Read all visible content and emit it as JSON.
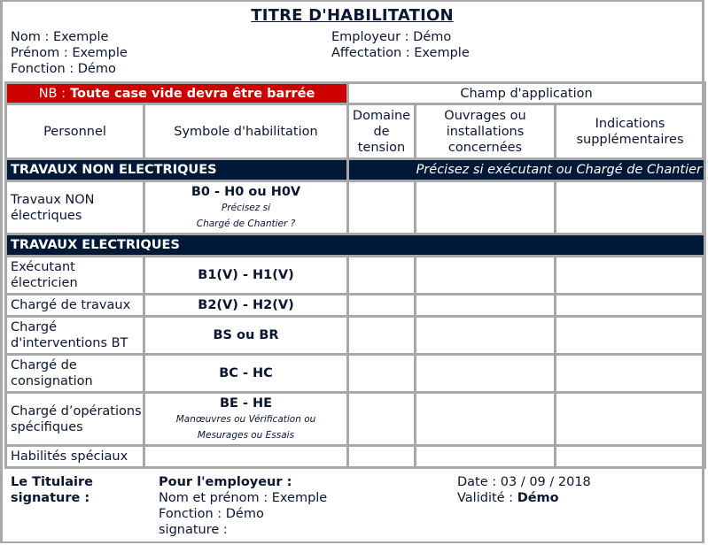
{
  "title": "TITRE D'HABILITATION",
  "person": {
    "nom_label": "Nom :",
    "nom": "Exemple",
    "prenom_label": "Prénom :",
    "prenom": "Exemple",
    "fonction_label": "Fonction :",
    "fonction": "Démo"
  },
  "company": {
    "employeur_label": "Employeur :",
    "employeur": "Démo",
    "affectation_label": "Affectation :",
    "affectation": "Exemple"
  },
  "notice": {
    "prefix": "NB :",
    "text": "Toute case vide devra être barrée",
    "color": "#cc0000"
  },
  "headers": {
    "champ": "Champ d'application",
    "personnel": "Personnel",
    "symbole": "Symbole d'habilitation",
    "domaine": "Domaine de tension",
    "ouvrages": "Ouvrages ou installations concernées",
    "indications": "Indications supplémentaires"
  },
  "sections": {
    "non_electriques": {
      "title": "TRAVAUX NON ELECTRIQUES",
      "note": "Précisez si exécutant ou Chargé de Chantier",
      "rows": [
        {
          "personnel": "Travaux NON électriques",
          "symbole": "B0 - H0 ou H0V",
          "sub1": "Précisez si",
          "sub2": "Chargé de Chantier ?",
          "domaine": "",
          "ouvrages": "",
          "indications": ""
        }
      ]
    },
    "electriques": {
      "title": "TRAVAUX ELECTRIQUES",
      "rows": [
        {
          "personnel": "Exécutant électricien",
          "symbole": "B1(V) - H1(V)",
          "sub1": "",
          "sub2": "",
          "domaine": "",
          "ouvrages": "",
          "indications": ""
        },
        {
          "personnel": "Chargé de travaux",
          "symbole": "B2(V) - H2(V)",
          "sub1": "",
          "sub2": "",
          "domaine": "",
          "ouvrages": "",
          "indications": ""
        },
        {
          "personnel": "Chargé d'interventions BT",
          "symbole": "BS ou BR",
          "sub1": "",
          "sub2": "",
          "domaine": "",
          "ouvrages": "",
          "indications": ""
        },
        {
          "personnel": "Chargé de consignation",
          "symbole": "BC - HC",
          "sub1": "",
          "sub2": "",
          "domaine": "",
          "ouvrages": "",
          "indications": ""
        },
        {
          "personnel": "Chargé d’opérations spécifiques",
          "symbole": "BE - HE",
          "sub1": "Manœuvres ou Vérification ou",
          "sub2": "Mesurages ou Essais",
          "domaine": "",
          "ouvrages": "",
          "indications": ""
        },
        {
          "personnel": "Habilités spéciaux",
          "symbole": "",
          "sub1": "",
          "sub2": "",
          "domaine": "",
          "ouvrages": "",
          "indications": ""
        }
      ]
    }
  },
  "footer": {
    "titulaire_line1": "Le Titulaire",
    "titulaire_line2": "signature :",
    "employeur_heading": "Pour l'employeur :",
    "nom_prenom_label": "Nom et prénom :",
    "nom_prenom": "Exemple",
    "fonction_label": "Fonction :",
    "fonction": "Démo",
    "signature_label": "signature :",
    "date_label": "Date :",
    "date": "03 / 09 / 2018",
    "validite_label": "Validité :",
    "validite": "Démo"
  },
  "colors": {
    "navy": "#021837",
    "red": "#cc0000",
    "border": "#a8a8a8",
    "text": "#0a1633"
  }
}
